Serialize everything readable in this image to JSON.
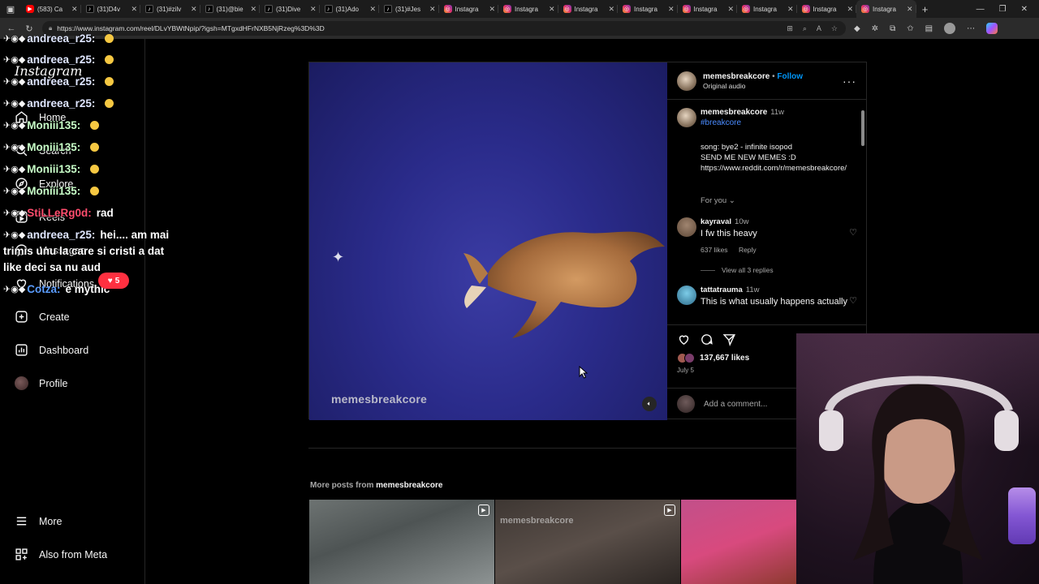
{
  "browser": {
    "tabs": [
      {
        "title": "(583) Ca",
        "icon": "youtube-icon"
      },
      {
        "title": "(31)D4v",
        "icon": "tiktok-icon"
      },
      {
        "title": "(31)#zilv",
        "icon": "tiktok-icon"
      },
      {
        "title": "(31)@bie",
        "icon": "tiktok-icon"
      },
      {
        "title": "(31)Dive",
        "icon": "tiktok-icon"
      },
      {
        "title": "(31)Ado",
        "icon": "tiktok-icon"
      },
      {
        "title": "(31)#Jes",
        "icon": "tiktok-icon"
      },
      {
        "title": "Instagra",
        "icon": "instagram-icon"
      },
      {
        "title": "Instagra",
        "icon": "instagram-icon"
      },
      {
        "title": "Instagra",
        "icon": "instagram-icon"
      },
      {
        "title": "Instagra",
        "icon": "instagram-icon"
      },
      {
        "title": "Instagra",
        "icon": "instagram-icon"
      },
      {
        "title": "Instagra",
        "icon": "instagram-icon"
      },
      {
        "title": "Instagra",
        "icon": "instagram-icon"
      },
      {
        "title": "Instagra",
        "icon": "instagram-icon",
        "active": true
      }
    ],
    "url": "https://www.instagram.com/reel/DLvYBWtNpip/?igsh=MTgxdHFrNXB5NjRzeg%3D%3D"
  },
  "sidebar": {
    "logo": "Instagram",
    "items": [
      {
        "label": "Home",
        "icon": "home-icon"
      },
      {
        "label": "Search",
        "icon": "search-icon"
      },
      {
        "label": "Explore",
        "icon": "compass-icon"
      },
      {
        "label": "Reels",
        "icon": "reels-icon"
      },
      {
        "label": "Messages",
        "icon": "messenger-icon"
      },
      {
        "label": "Notifications",
        "icon": "heart-icon"
      },
      {
        "label": "Create",
        "icon": "plus-square-icon"
      },
      {
        "label": "Dashboard",
        "icon": "chart-icon"
      },
      {
        "label": "Profile",
        "icon": "avatar-icon"
      }
    ],
    "bottom": [
      {
        "label": "More",
        "icon": "menu-icon"
      },
      {
        "label": "Also from Meta",
        "icon": "meta-icon"
      }
    ],
    "notification_count": "5"
  },
  "chat": [
    {
      "user": "andreea_r25:",
      "msg": "",
      "color": "#dfe6ff"
    },
    {
      "user": "andreea_r25:",
      "msg": "",
      "color": "#dfe6ff"
    },
    {
      "user": "andreea_r25:",
      "msg": "",
      "color": "#dfe6ff"
    },
    {
      "user": "andreea_r25:",
      "msg": "",
      "color": "#dfe6ff"
    },
    {
      "user": "Moniii135:",
      "msg": "",
      "color": "#c8ffc8"
    },
    {
      "user": "Moniii135:",
      "msg": "",
      "color": "#c8ffc8"
    },
    {
      "user": "Moniii135:",
      "msg": "",
      "color": "#c8ffc8"
    },
    {
      "user": "Moniii135:",
      "msg": "",
      "color": "#c8ffc8"
    },
    {
      "user": "StiLLeRg0d:",
      "msg": "rad",
      "color": "#ff4d6d"
    },
    {
      "user": "andreea_r25:",
      "msg": "hei.... am mai",
      "color": "#dfe6ff"
    },
    {
      "user": "",
      "msg": "trimis unu la care si cristi a dat",
      "color": "#ffffff"
    },
    {
      "user": "",
      "msg": "like deci sa nu aud",
      "color": "#ffffff"
    },
    {
      "user": "Cotza:",
      "msg": "e mythic",
      "color": "#5b9dff"
    }
  ],
  "post": {
    "watermark": "memesbreakcore",
    "header": {
      "username": "memesbreakcore",
      "separator": "•",
      "follow": "Follow",
      "audio": "Original audio"
    },
    "caption": {
      "username": "memesbreakcore",
      "time": "11w",
      "hashtag": "#breakcore",
      "body_lines": [
        "song: bye2 - infinite isopod",
        "SEND ME NEW MEMES :D",
        "https://www.reddit.com/r/memesbreakcore/"
      ]
    },
    "for_you": "For you",
    "comments": [
      {
        "user": "kayraval",
        "time": "10w",
        "text": "I fw this heavy",
        "likes": "637 likes",
        "reply": "Reply",
        "view_replies": "View all 3 replies"
      },
      {
        "user": "tattatrauma",
        "time": "11w",
        "text": "This is what usually happens actually"
      }
    ],
    "likes": "137,667 likes",
    "date": "July 5",
    "add_comment_placeholder": "Add a comment..."
  },
  "more_posts": {
    "prefix": "More posts from",
    "username": "memesbreakcore",
    "thumb_watermark": "memesbreakcore"
  }
}
